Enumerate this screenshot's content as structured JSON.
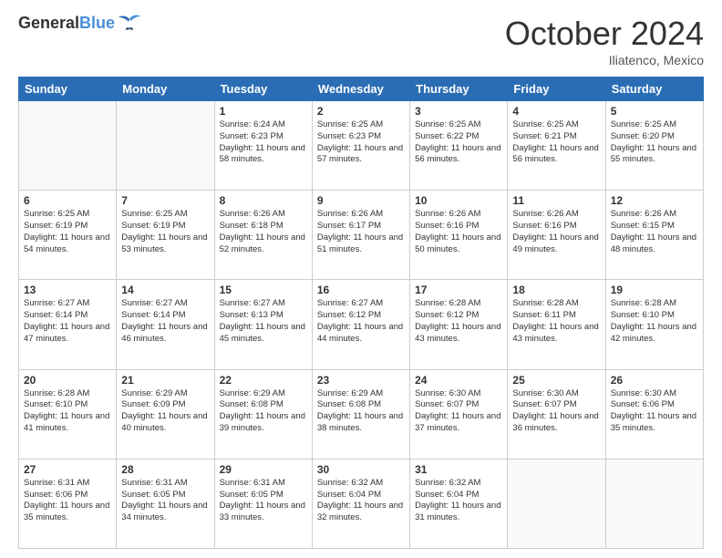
{
  "header": {
    "logo_line1": "General",
    "logo_line2": "Blue",
    "month": "October 2024",
    "location": "Iliatenco, Mexico"
  },
  "weekdays": [
    "Sunday",
    "Monday",
    "Tuesday",
    "Wednesday",
    "Thursday",
    "Friday",
    "Saturday"
  ],
  "weeks": [
    [
      {
        "day": null
      },
      {
        "day": null
      },
      {
        "day": "1",
        "sunrise": "6:24 AM",
        "sunset": "6:23 PM",
        "daylight": "11 hours and 58 minutes."
      },
      {
        "day": "2",
        "sunrise": "6:25 AM",
        "sunset": "6:23 PM",
        "daylight": "11 hours and 57 minutes."
      },
      {
        "day": "3",
        "sunrise": "6:25 AM",
        "sunset": "6:22 PM",
        "daylight": "11 hours and 56 minutes."
      },
      {
        "day": "4",
        "sunrise": "6:25 AM",
        "sunset": "6:21 PM",
        "daylight": "11 hours and 56 minutes."
      },
      {
        "day": "5",
        "sunrise": "6:25 AM",
        "sunset": "6:20 PM",
        "daylight": "11 hours and 55 minutes."
      }
    ],
    [
      {
        "day": "6",
        "sunrise": "6:25 AM",
        "sunset": "6:19 PM",
        "daylight": "11 hours and 54 minutes."
      },
      {
        "day": "7",
        "sunrise": "6:25 AM",
        "sunset": "6:19 PM",
        "daylight": "11 hours and 53 minutes."
      },
      {
        "day": "8",
        "sunrise": "6:26 AM",
        "sunset": "6:18 PM",
        "daylight": "11 hours and 52 minutes."
      },
      {
        "day": "9",
        "sunrise": "6:26 AM",
        "sunset": "6:17 PM",
        "daylight": "11 hours and 51 minutes."
      },
      {
        "day": "10",
        "sunrise": "6:26 AM",
        "sunset": "6:16 PM",
        "daylight": "11 hours and 50 minutes."
      },
      {
        "day": "11",
        "sunrise": "6:26 AM",
        "sunset": "6:16 PM",
        "daylight": "11 hours and 49 minutes."
      },
      {
        "day": "12",
        "sunrise": "6:26 AM",
        "sunset": "6:15 PM",
        "daylight": "11 hours and 48 minutes."
      }
    ],
    [
      {
        "day": "13",
        "sunrise": "6:27 AM",
        "sunset": "6:14 PM",
        "daylight": "11 hours and 47 minutes."
      },
      {
        "day": "14",
        "sunrise": "6:27 AM",
        "sunset": "6:14 PM",
        "daylight": "11 hours and 46 minutes."
      },
      {
        "day": "15",
        "sunrise": "6:27 AM",
        "sunset": "6:13 PM",
        "daylight": "11 hours and 45 minutes."
      },
      {
        "day": "16",
        "sunrise": "6:27 AM",
        "sunset": "6:12 PM",
        "daylight": "11 hours and 44 minutes."
      },
      {
        "day": "17",
        "sunrise": "6:28 AM",
        "sunset": "6:12 PM",
        "daylight": "11 hours and 43 minutes."
      },
      {
        "day": "18",
        "sunrise": "6:28 AM",
        "sunset": "6:11 PM",
        "daylight": "11 hours and 43 minutes."
      },
      {
        "day": "19",
        "sunrise": "6:28 AM",
        "sunset": "6:10 PM",
        "daylight": "11 hours and 42 minutes."
      }
    ],
    [
      {
        "day": "20",
        "sunrise": "6:28 AM",
        "sunset": "6:10 PM",
        "daylight": "11 hours and 41 minutes."
      },
      {
        "day": "21",
        "sunrise": "6:29 AM",
        "sunset": "6:09 PM",
        "daylight": "11 hours and 40 minutes."
      },
      {
        "day": "22",
        "sunrise": "6:29 AM",
        "sunset": "6:08 PM",
        "daylight": "11 hours and 39 minutes."
      },
      {
        "day": "23",
        "sunrise": "6:29 AM",
        "sunset": "6:08 PM",
        "daylight": "11 hours and 38 minutes."
      },
      {
        "day": "24",
        "sunrise": "6:30 AM",
        "sunset": "6:07 PM",
        "daylight": "11 hours and 37 minutes."
      },
      {
        "day": "25",
        "sunrise": "6:30 AM",
        "sunset": "6:07 PM",
        "daylight": "11 hours and 36 minutes."
      },
      {
        "day": "26",
        "sunrise": "6:30 AM",
        "sunset": "6:06 PM",
        "daylight": "11 hours and 35 minutes."
      }
    ],
    [
      {
        "day": "27",
        "sunrise": "6:31 AM",
        "sunset": "6:06 PM",
        "daylight": "11 hours and 35 minutes."
      },
      {
        "day": "28",
        "sunrise": "6:31 AM",
        "sunset": "6:05 PM",
        "daylight": "11 hours and 34 minutes."
      },
      {
        "day": "29",
        "sunrise": "6:31 AM",
        "sunset": "6:05 PM",
        "daylight": "11 hours and 33 minutes."
      },
      {
        "day": "30",
        "sunrise": "6:32 AM",
        "sunset": "6:04 PM",
        "daylight": "11 hours and 32 minutes."
      },
      {
        "day": "31",
        "sunrise": "6:32 AM",
        "sunset": "6:04 PM",
        "daylight": "11 hours and 31 minutes."
      },
      {
        "day": null
      },
      {
        "day": null
      }
    ]
  ],
  "labels": {
    "sunrise": "Sunrise:",
    "sunset": "Sunset:",
    "daylight": "Daylight:"
  }
}
